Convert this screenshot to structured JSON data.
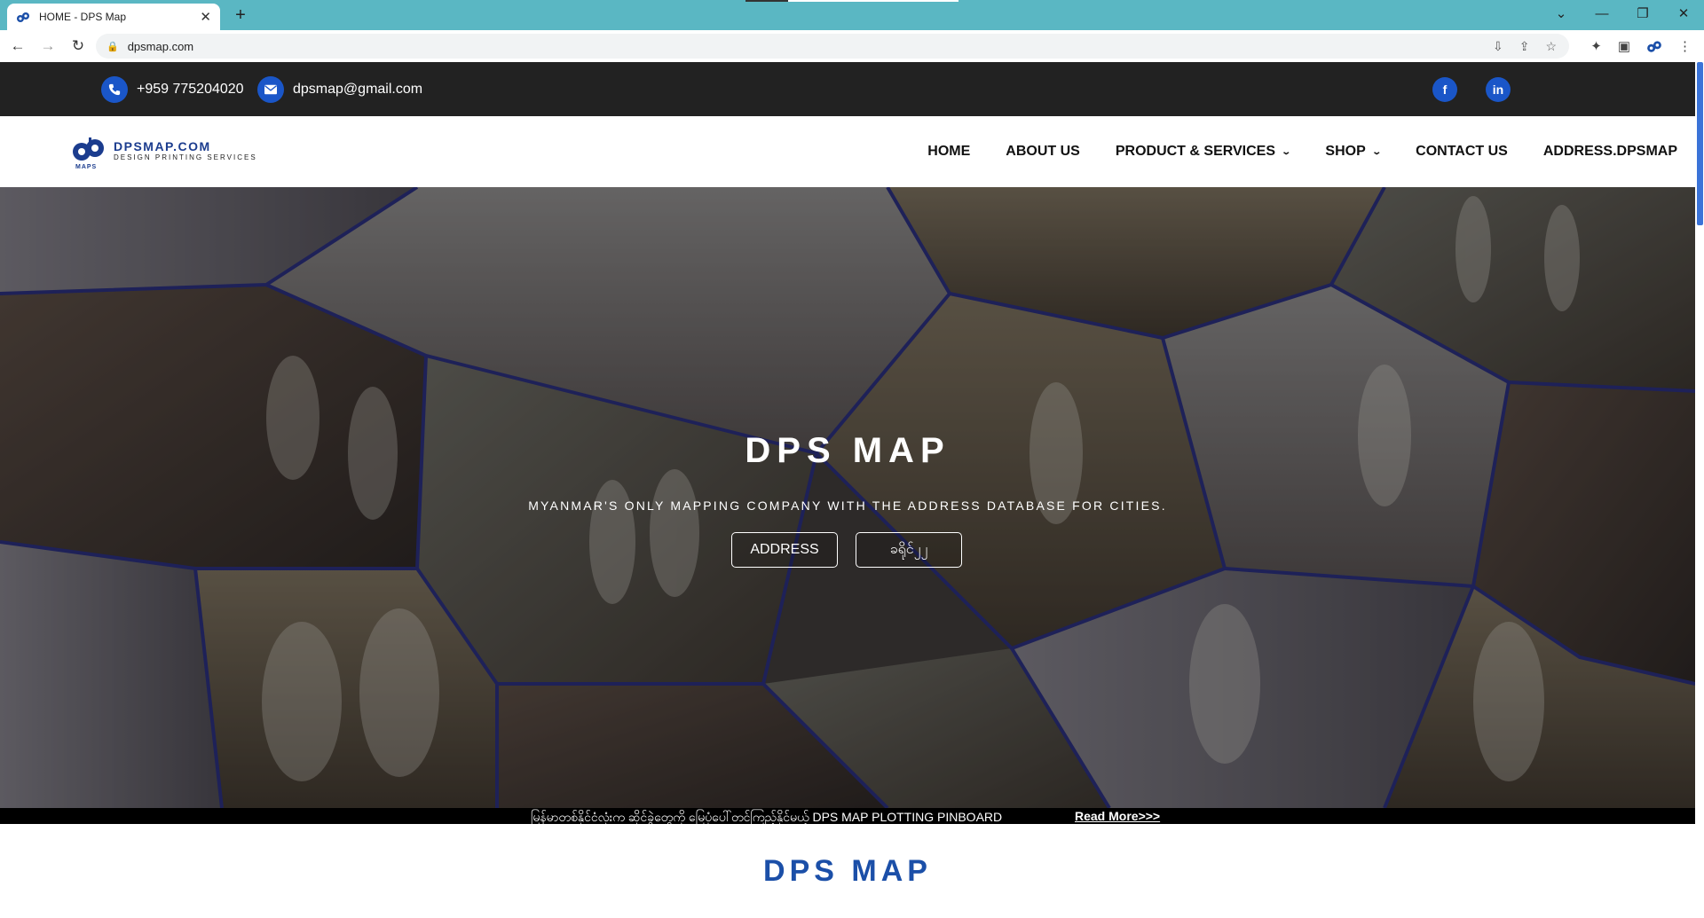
{
  "browser": {
    "tab_title": "HOME - DPS Map",
    "tab_close": "✕",
    "new_tab": "+",
    "url": "dpsmap.com",
    "window_controls": [
      "⌄",
      "—",
      "❐",
      "✕"
    ]
  },
  "topbar": {
    "phone": "+959 775204020",
    "email": "dpsmap@gmail.com",
    "social": [
      "f",
      "in"
    ]
  },
  "logo": {
    "name": "DPSMAP.COM",
    "tagline": "DESIGN PRINTING SERVICES",
    "mark_text": "MAPS"
  },
  "nav": {
    "items": [
      {
        "label": "HOME"
      },
      {
        "label": "ABOUT US"
      },
      {
        "label": "PRODUCT & SERVICES"
      },
      {
        "label": "SHOP"
      },
      {
        "label": "CONTACT US"
      },
      {
        "label": "ADDRESS.DPSMAP"
      }
    ]
  },
  "hero": {
    "title": "DPS MAP",
    "subtitle": "Myanmar's only mapping company with the address database for cities.",
    "buttons": [
      "ADDRESS",
      "ခရိုင်၂၂"
    ]
  },
  "ticker": {
    "text": "မြန်မာတစ်နိုင်ငံလုံးက ဆိုင်ခွဲတွေကို မြေပုံပေါ်တင်ကြည့်နိုင်မယ့် DPS MAP PLOTTING PINBOARD",
    "link": "Read More>>>"
  },
  "section": {
    "title": "DPS MAP"
  },
  "colors": {
    "tabstrip": "#5ab7c3",
    "accent": "#1a56c8",
    "brand_blue": "#1b4fa8",
    "topbar_bg": "#222222"
  }
}
